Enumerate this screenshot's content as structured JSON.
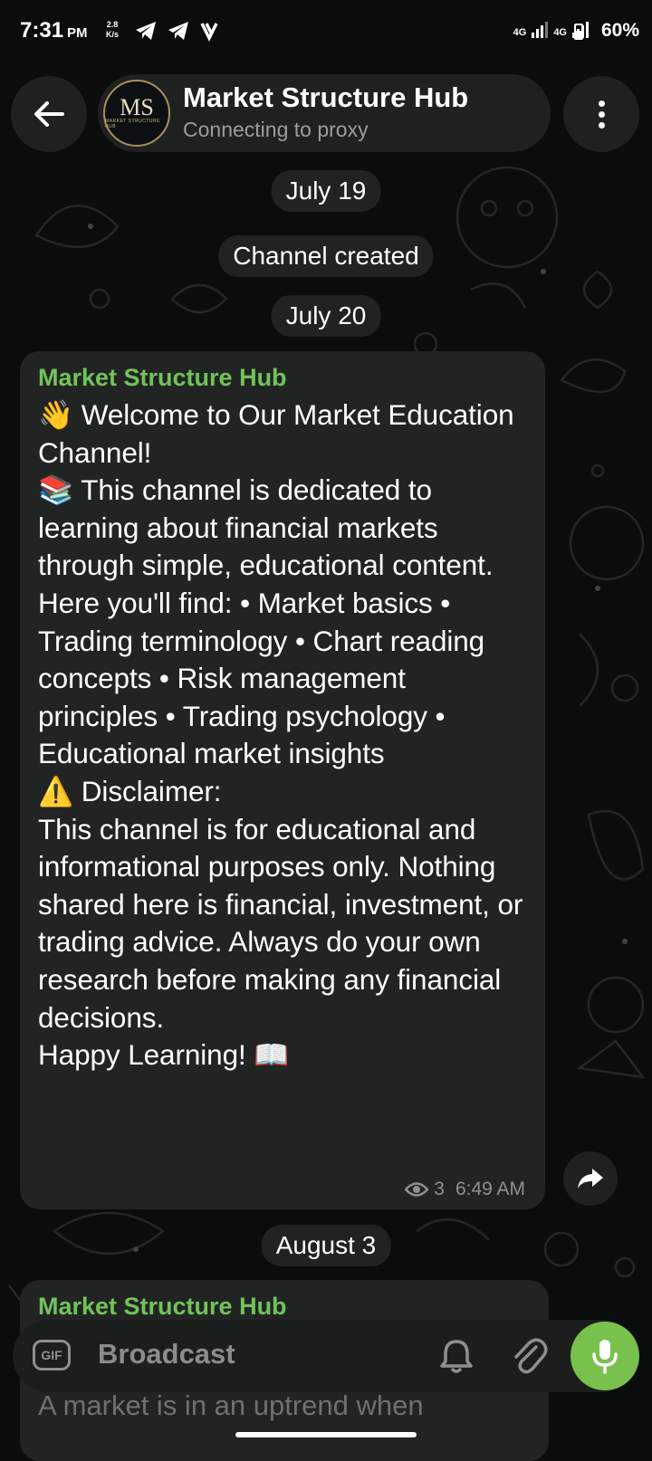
{
  "status_bar": {
    "time": "7:31",
    "ampm": "PM",
    "net_speed": "2.8",
    "net_unit": "K/s",
    "network1": "4G",
    "network2": "4G",
    "battery": "60%"
  },
  "header": {
    "avatar_mono": "MS",
    "avatar_caption": "MARKET STRUCTURE HUB",
    "title": "Market Structure Hub",
    "status": "Connecting to proxy"
  },
  "chips": {
    "date1": "July 19",
    "service": "Channel created",
    "date2": "July 20",
    "date3": "August 3"
  },
  "message1": {
    "sender": "Market Structure Hub",
    "body": "👋 Welcome to Our Market Education Channel!\n📚 This channel is dedicated to learning about financial markets through simple, educational content.\nHere you'll find: • Market basics • Trading terminology • Chart reading concepts • Risk management principles • Trading psychology • Educational market insights\n⚠️ Disclaimer:\nThis channel is for educational and informational purposes only. Nothing shared here is financial, investment, or trading advice. Always do your own research before making any financial decisions.\nHappy Learning! 📖",
    "views": "3",
    "time": "6:49 AM"
  },
  "message2": {
    "sender": "Market Structure Hub",
    "peek": "A market is in an uptrend when"
  },
  "input_bar": {
    "gif_label": "GIF",
    "placeholder": "Broadcast"
  }
}
